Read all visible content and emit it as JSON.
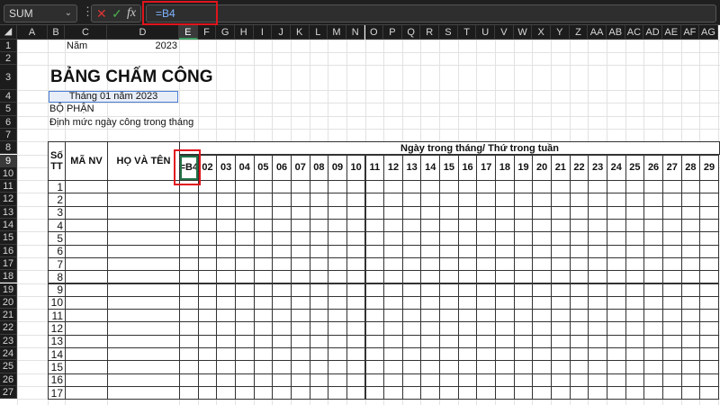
{
  "formula_bar": {
    "name_box": "SUM",
    "cancel_icon": "✕",
    "enter_icon": "✓",
    "fx_label": "fx",
    "formula": "=B4"
  },
  "columns": [
    "A",
    "B",
    "C",
    "D",
    "E",
    "F",
    "G",
    "H",
    "I",
    "J",
    "K",
    "L",
    "M",
    "N",
    "O",
    "P",
    "Q",
    "R",
    "S",
    "T",
    "U",
    "V",
    "W",
    "X",
    "Y",
    "Z",
    "AA",
    "AB",
    "AC",
    "AD",
    "AE",
    "AF",
    "AG"
  ],
  "rows": [
    "1",
    "2",
    "3",
    "4",
    "5",
    "6",
    "7",
    "8",
    "9",
    "10",
    "11",
    "12",
    "13",
    "14",
    "15",
    "16",
    "17",
    "18",
    "19",
    "20",
    "21",
    "22",
    "23",
    "24",
    "25",
    "26",
    "27"
  ],
  "selected": {
    "column": "E",
    "row": "9"
  },
  "cells": {
    "c1_label": "Năm",
    "d1_year": "2023",
    "title": "BẢNG CHẤM CÔNG",
    "month_label": "Tháng 01 năm 2023",
    "department": "BỘ PHẬN",
    "quota": "Định mức ngày công trong tháng"
  },
  "table": {
    "stt_header": "Số TT",
    "code_header": "MÃ NV",
    "name_header": "HỌ VÀ TÊN",
    "days_header": "Ngày trong tháng/ Thứ trong tuần",
    "days": [
      "=B4",
      "02",
      "03",
      "04",
      "05",
      "06",
      "07",
      "08",
      "09",
      "10",
      "11",
      "12",
      "13",
      "14",
      "15",
      "16",
      "17",
      "18",
      "19",
      "20",
      "21",
      "22",
      "23",
      "24",
      "25",
      "26",
      "27",
      "28",
      "29"
    ],
    "row_numbers": [
      "1",
      "2",
      "3",
      "4",
      "5",
      "6",
      "7",
      "8",
      "9",
      "10",
      "11",
      "12",
      "13",
      "14",
      "15",
      "16",
      "17"
    ]
  },
  "colors": {
    "accent_red": "#e0141c",
    "selection_green": "#217346"
  }
}
